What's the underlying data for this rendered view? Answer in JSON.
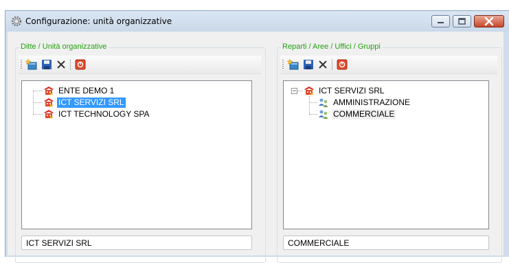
{
  "window": {
    "title": "Configurazione: unità organizzative",
    "controls": {
      "minimize": "minimize-icon",
      "maximize": "maximize-icon",
      "close": "close-icon"
    }
  },
  "left_panel": {
    "group_label": "Ditte / Unità organizzative",
    "toolbar": [
      "new-icon",
      "save-icon",
      "delete-icon",
      "stop-icon"
    ],
    "tree": [
      {
        "label": "ENTE DEMO 1",
        "icon": "company-icon",
        "selected": false
      },
      {
        "label": "ICT SERVIZI SRL",
        "icon": "company-icon",
        "selected": true
      },
      {
        "label": "ICT TECHNOLOGY SPA",
        "icon": "company-icon",
        "selected": false
      }
    ],
    "field_value": "ICT SERVIZI SRL"
  },
  "right_panel": {
    "group_label": "Reparti / Aree / Uffici / Gruppi",
    "toolbar": [
      "new-icon",
      "save-icon",
      "delete-icon",
      "stop-icon"
    ],
    "tree": {
      "root": {
        "label": "ICT SERVIZI SRL",
        "icon": "company-icon",
        "expanded": true,
        "expander": "−"
      },
      "children": [
        {
          "label": "AMMINISTRAZIONE",
          "icon": "department-icon",
          "selected": false
        },
        {
          "label": "COMMERCIALE",
          "icon": "department-icon",
          "selected": true
        }
      ]
    },
    "field_value": "COMMERCIALE"
  },
  "colors": {
    "group_label": "#1fa20c",
    "selection": "#3399ff",
    "window_frame": "#cfdceb"
  }
}
